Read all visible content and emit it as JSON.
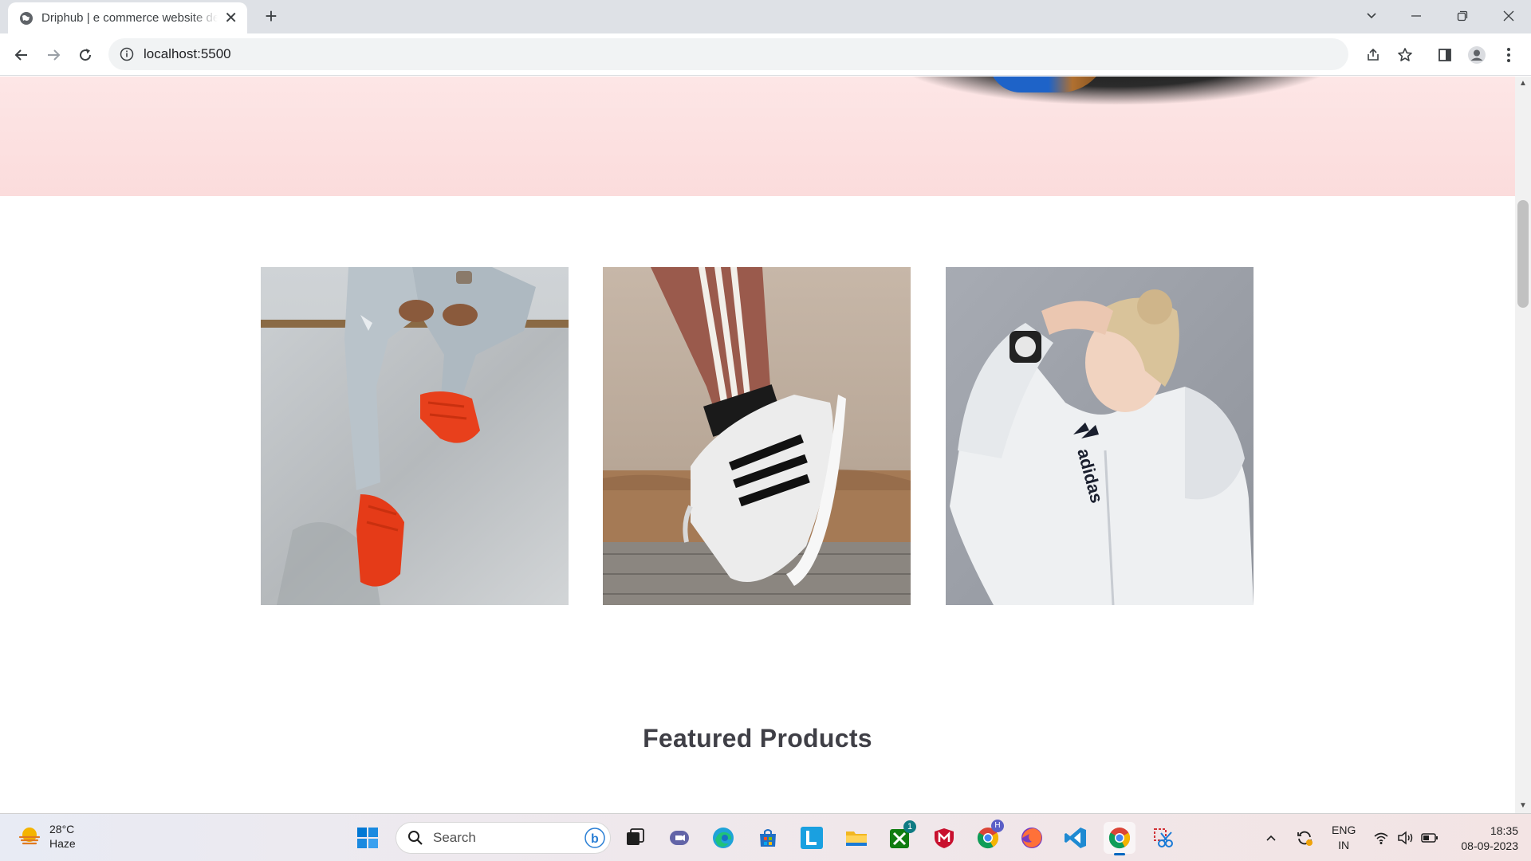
{
  "browser": {
    "tab_title": "Driphub | e commerce website design",
    "address": "localhost:5500"
  },
  "page": {
    "section_title": "Featured Products",
    "banners": [
      {
        "name": "banner-red-sneakers"
      },
      {
        "name": "banner-superstar-shoe"
      },
      {
        "name": "banner-adidas-hoodie"
      }
    ]
  },
  "taskbar": {
    "weather_temp": "28°C",
    "weather_desc": "Haze",
    "search_placeholder": "Search",
    "language_top": "ENG",
    "language_bottom": "IN",
    "time": "18:35",
    "date": "08-09-2023",
    "xbox_badge": "1",
    "chrome_profile_badge": "H"
  },
  "colors": {
    "hero_band": "#fde6e6",
    "title_text": "#3f3f46",
    "taskbar": "#eee9ee"
  }
}
